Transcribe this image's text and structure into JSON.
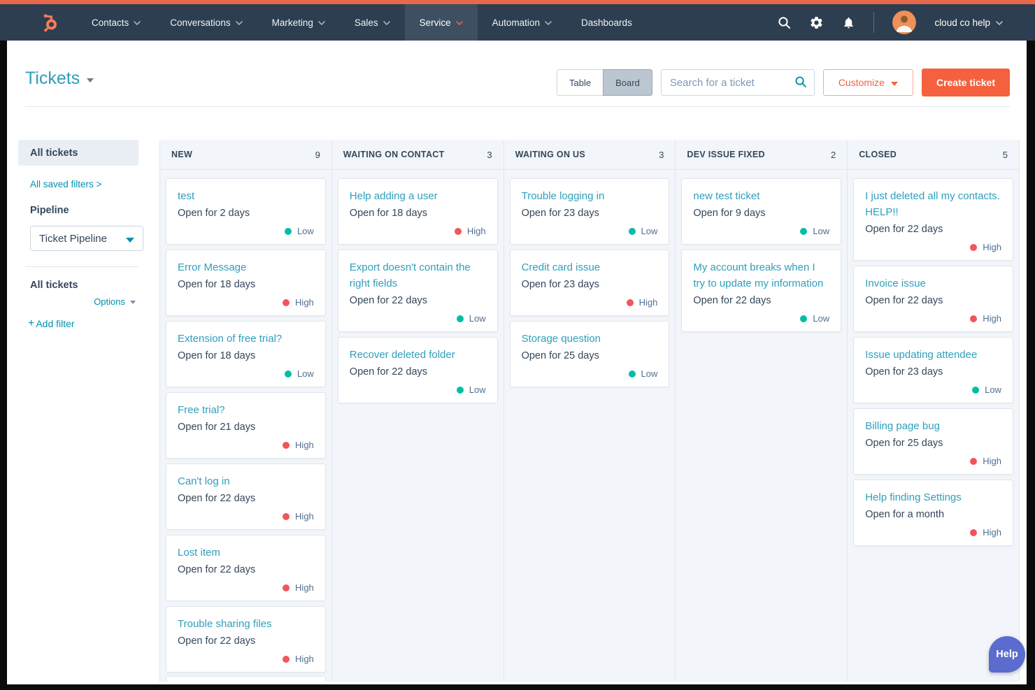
{
  "nav": {
    "items": [
      {
        "label": "Contacts",
        "caret": true,
        "active": false
      },
      {
        "label": "Conversations",
        "caret": true,
        "active": false
      },
      {
        "label": "Marketing",
        "caret": true,
        "active": false
      },
      {
        "label": "Sales",
        "caret": true,
        "active": false
      },
      {
        "label": "Service",
        "caret": true,
        "active": true
      },
      {
        "label": "Automation",
        "caret": true,
        "active": false
      },
      {
        "label": "Dashboards",
        "caret": false,
        "active": false
      }
    ],
    "account_label": "cloud co help"
  },
  "header": {
    "title": "Tickets",
    "views": [
      "Table",
      "Board"
    ],
    "active_view": "Board",
    "search_placeholder": "Search for a ticket",
    "customize_label": "Customize",
    "create_label": "Create ticket"
  },
  "sidebar": {
    "selected_view": "All tickets",
    "saved_filters_link": "All saved filters >",
    "pipeline_label": "Pipeline",
    "pipeline_value": "Ticket Pipeline",
    "filters_title": "All tickets",
    "options_label": "Options",
    "add_filter_label": "Add filter"
  },
  "board": {
    "columns": [
      {
        "name": "NEW",
        "count": 9,
        "partial_card_visible": true,
        "cards": [
          {
            "title": "test",
            "subtitle": "Open for 2 days",
            "priority": "Low"
          },
          {
            "title": "Error Message",
            "subtitle": "Open for 18 days",
            "priority": "High"
          },
          {
            "title": "Extension of free trial?",
            "subtitle": "Open for 18 days",
            "priority": "Low"
          },
          {
            "title": "Free trial?",
            "subtitle": "Open for 21 days",
            "priority": "High"
          },
          {
            "title": "Can't log in",
            "subtitle": "Open for 22 days",
            "priority": "High"
          },
          {
            "title": "Lost item",
            "subtitle": "Open for 22 days",
            "priority": "High"
          },
          {
            "title": "Trouble sharing files",
            "subtitle": "Open for 22 days",
            "priority": "High"
          }
        ]
      },
      {
        "name": "WAITING ON CONTACT",
        "count": 3,
        "partial_card_visible": false,
        "cards": [
          {
            "title": "Help adding a user",
            "subtitle": "Open for 18 days",
            "priority": "High"
          },
          {
            "title": "Export doesn't contain the right fields",
            "subtitle": "Open for 22 days",
            "priority": "Low"
          },
          {
            "title": "Recover deleted folder",
            "subtitle": "Open for 22 days",
            "priority": "Low"
          }
        ]
      },
      {
        "name": "WAITING ON US",
        "count": 3,
        "partial_card_visible": false,
        "cards": [
          {
            "title": "Trouble logging in",
            "subtitle": "Open for 23 days",
            "priority": "Low"
          },
          {
            "title": "Credit card issue",
            "subtitle": "Open for 23 days",
            "priority": "High"
          },
          {
            "title": "Storage question",
            "subtitle": "Open for 25 days",
            "priority": "Low"
          }
        ]
      },
      {
        "name": "DEV ISSUE FIXED",
        "count": 2,
        "partial_card_visible": false,
        "cards": [
          {
            "title": "new test ticket",
            "subtitle": "Open for 9 days",
            "priority": "Low"
          },
          {
            "title": "My account breaks when I try to update my information",
            "subtitle": "Open for 22 days",
            "priority": "Low"
          }
        ]
      },
      {
        "name": "CLOSED",
        "count": 5,
        "partial_card_visible": false,
        "cards": [
          {
            "title": "I just deleted all my contacts. HELP!!",
            "subtitle": "Open for 22 days",
            "priority": "High"
          },
          {
            "title": "Invoice issue",
            "subtitle": "Open for 22 days",
            "priority": "High"
          },
          {
            "title": "Issue updating attendee",
            "subtitle": "Open for 23 days",
            "priority": "Low"
          },
          {
            "title": "Billing page bug",
            "subtitle": "Open for 25 days",
            "priority": "High"
          },
          {
            "title": "Help finding Settings",
            "subtitle": "Open for a month",
            "priority": "High"
          }
        ]
      }
    ]
  },
  "help_button_label": "Help",
  "priority_colors": {
    "low": "#00bda5",
    "high": "#f2545b"
  },
  "colors": {
    "accent_orange": "#f5613e",
    "top_strip": "#e8684b",
    "nav_background": "#2d3e50",
    "link_teal": "#0091ae",
    "card_title_teal": "#2e9fbb",
    "help_purple": "#5b6cce"
  }
}
